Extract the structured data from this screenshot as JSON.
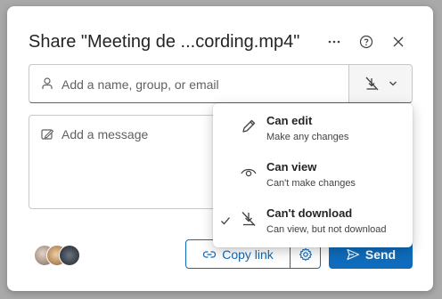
{
  "dialog": {
    "title": "Share \"Meeting de ...cording.mp4\"",
    "more_icon": "more-horizontal-icon",
    "help_icon": "help-circle-icon",
    "close_icon": "close-icon"
  },
  "recipient": {
    "placeholder": "Add a name, group, or email",
    "icon": "person-icon",
    "permission_icon": "cant-download-icon"
  },
  "message": {
    "placeholder": "Add a message",
    "icon": "edit-note-icon"
  },
  "permission_menu": {
    "items": [
      {
        "title": "Can edit",
        "subtitle": "Make any changes",
        "icon": "pencil-icon",
        "selected": false
      },
      {
        "title": "Can view",
        "subtitle": "Can't make changes",
        "icon": "eye-icon",
        "selected": false
      },
      {
        "title": "Can't download",
        "subtitle": "Can view, but not download",
        "icon": "cant-download-icon",
        "selected": true
      }
    ]
  },
  "footer": {
    "copy_link_label": "Copy link",
    "send_label": "Send",
    "avatars": 3
  },
  "colors": {
    "accent": "#0f6cbd",
    "backdrop": "#a9a9a9"
  }
}
